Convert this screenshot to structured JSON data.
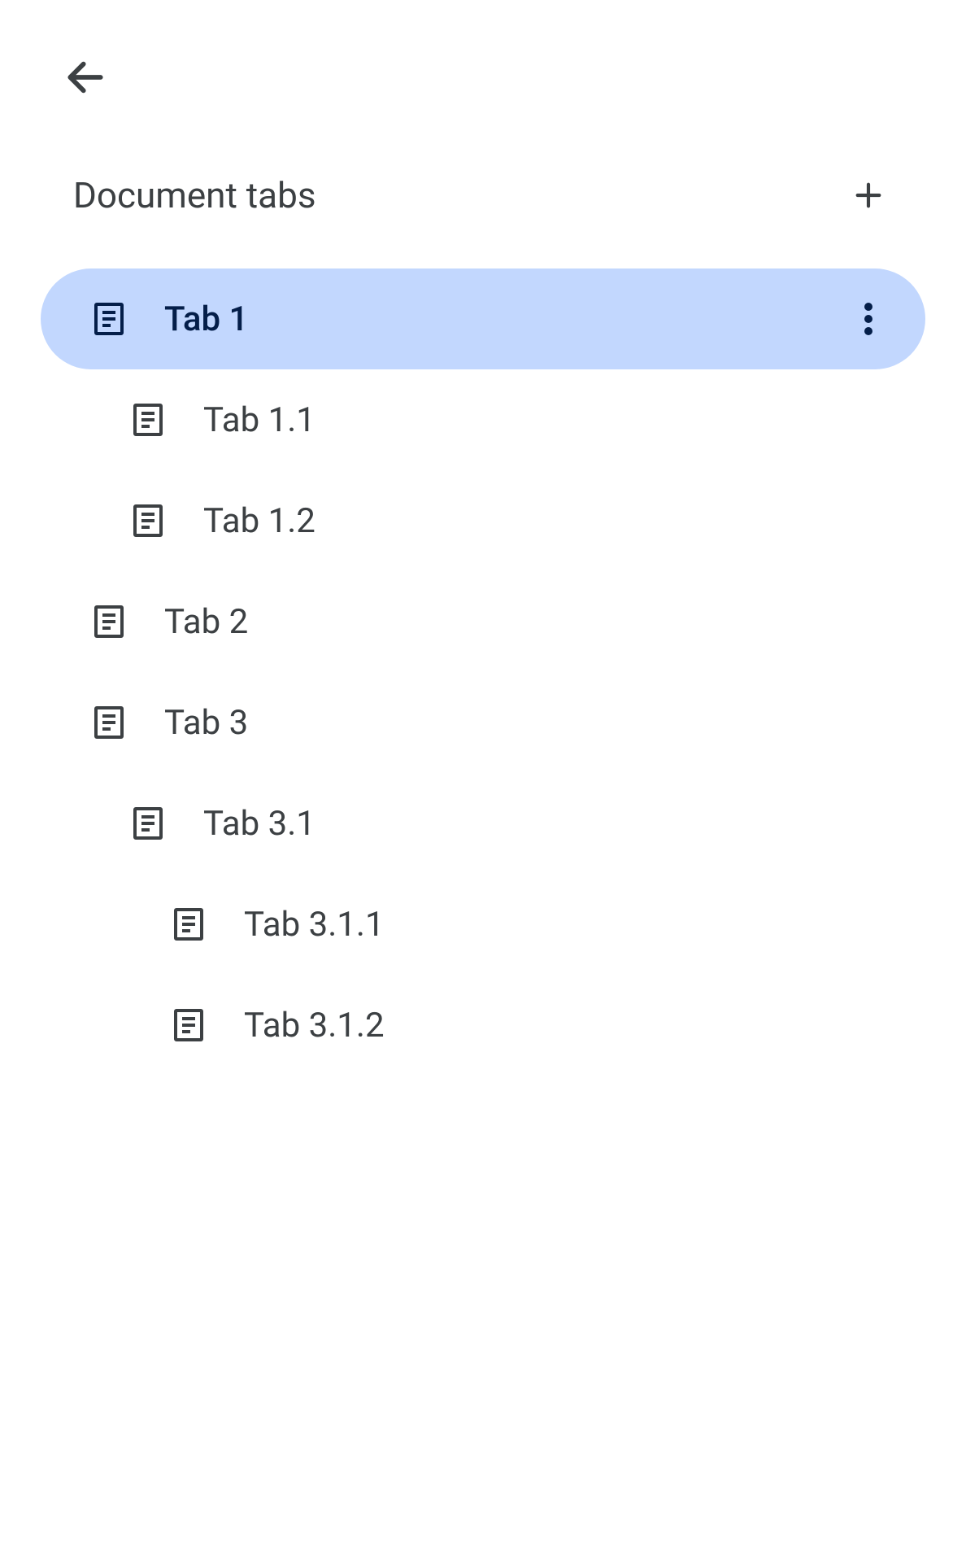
{
  "header": {
    "title": "Document tabs"
  },
  "tabs": [
    {
      "label": "Tab 1",
      "level": 0,
      "selected": true
    },
    {
      "label": "Tab 1.1",
      "level": 1,
      "selected": false
    },
    {
      "label": "Tab 1.2",
      "level": 1,
      "selected": false
    },
    {
      "label": "Tab 2",
      "level": 0,
      "selected": false
    },
    {
      "label": "Tab 3",
      "level": 0,
      "selected": false
    },
    {
      "label": "Tab 3.1",
      "level": 1,
      "selected": false
    },
    {
      "label": "Tab 3.1.1",
      "level": 2,
      "selected": false
    },
    {
      "label": "Tab 3.1.2",
      "level": 2,
      "selected": false
    }
  ],
  "colors": {
    "selected_bg": "#c2d7fe",
    "selected_text": "#041e49",
    "text": "#3c4043",
    "icon": "#3c4043"
  }
}
